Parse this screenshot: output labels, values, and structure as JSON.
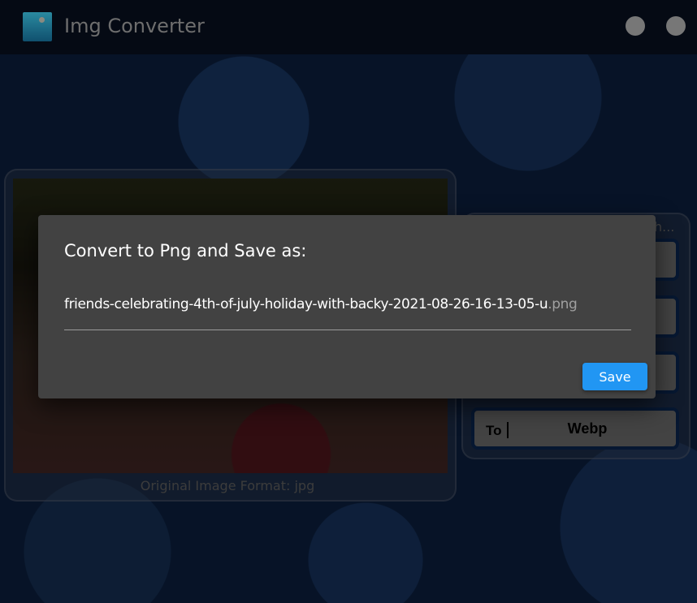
{
  "app": {
    "title": "Img Converter"
  },
  "header": {
    "icons": [
      "account-circle-icon",
      "github-icon"
    ]
  },
  "main": {
    "caption": "Original Image Format: jpg",
    "side_filename_truncated": "y-h...",
    "convert_button": {
      "prefix": "To",
      "format": "Webp"
    }
  },
  "dialog": {
    "title": "Convert to Png and Save as:",
    "filename": "friends-celebrating-4th-of-july-holiday-with-backy-2021-08-26-16-13-05-u",
    "extension": ".png",
    "save_label": "Save",
    "accent": "#2196f3"
  }
}
